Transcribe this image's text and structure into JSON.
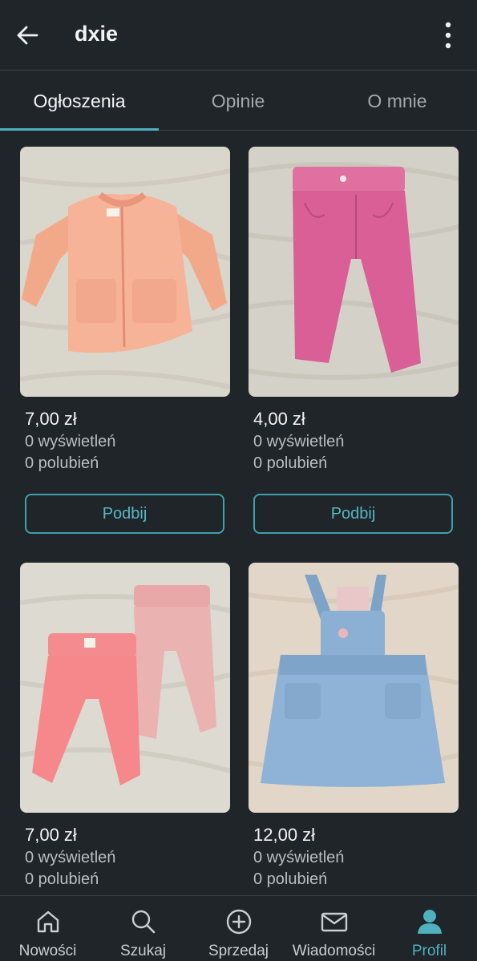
{
  "header": {
    "title": "dxie",
    "back_icon": "arrow-left-icon",
    "more_icon": "more-vertical-icon"
  },
  "tabs": [
    {
      "label": "Ogłoszenia",
      "active": true
    },
    {
      "label": "Opinie",
      "active": false
    },
    {
      "label": "O mnie",
      "active": false
    }
  ],
  "listings": [
    {
      "price": "7,00 zł",
      "views": "0 wyświetleń",
      "likes": "0 polubień",
      "action": "Podbij",
      "image": "peach-zip-jacket-photo"
    },
    {
      "price": "4,00 zł",
      "views": "0 wyświetleń",
      "likes": "0 polubień",
      "action": "Podbij",
      "image": "pink-corduroy-pants-photo"
    },
    {
      "price": "7,00 zł",
      "views": "0 wyświetleń",
      "likes": "0 polubień",
      "image": "pink-baby-leggings-photo"
    },
    {
      "price": "12,00 zł",
      "views": "0 wyświetleń",
      "likes": "0 polubień",
      "image": "denim-dungaree-dress-photo"
    }
  ],
  "bottom_nav": [
    {
      "label": "Nowości",
      "icon": "home-icon",
      "active": false
    },
    {
      "label": "Szukaj",
      "icon": "search-icon",
      "active": false
    },
    {
      "label": "Sprzedaj",
      "icon": "plus-circle-icon",
      "active": false
    },
    {
      "label": "Wiadomości",
      "icon": "mail-icon",
      "active": false
    },
    {
      "label": "Profil",
      "icon": "profile-icon",
      "active": true
    }
  ],
  "colors": {
    "background": "#1f2528",
    "accent": "#4fb1bd",
    "divider": "#3a4246"
  }
}
